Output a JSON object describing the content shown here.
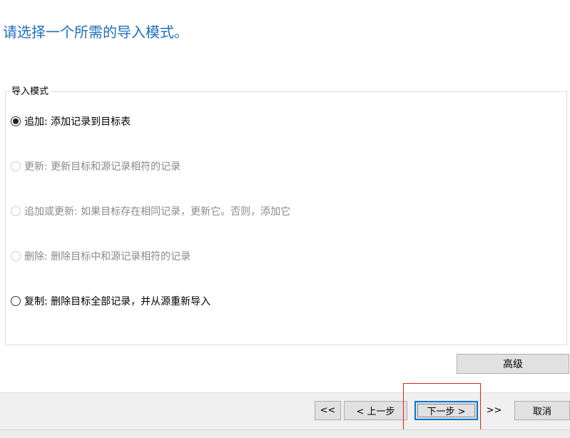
{
  "page": {
    "title": "请选择一个所需的导入模式。"
  },
  "import_mode": {
    "legend": "导入模式",
    "options": [
      {
        "label": "追加: 添加记录到目标表",
        "selected": true,
        "enabled": true
      },
      {
        "label": "更新: 更新目标和源记录相符的记录",
        "selected": false,
        "enabled": false
      },
      {
        "label": "追加或更新: 如果目标存在相同记录，更新它。否则，添加它",
        "selected": false,
        "enabled": false
      },
      {
        "label": "删除: 删除目标中和源记录相符的记录",
        "selected": false,
        "enabled": false
      },
      {
        "label": "复制: 删除目标全部记录，并从源重新导入",
        "selected": false,
        "enabled": true
      }
    ]
  },
  "advanced": {
    "label": "高级"
  },
  "footer": {
    "first_label": "<<",
    "prev_label": "< 上一步",
    "next_label": "下一步 >",
    "last_label": ">>",
    "cancel_label": "取消"
  },
  "colors": {
    "title": "#1f6fbf",
    "highlight": "#e02020",
    "disabled_text": "#8a8a8a"
  }
}
